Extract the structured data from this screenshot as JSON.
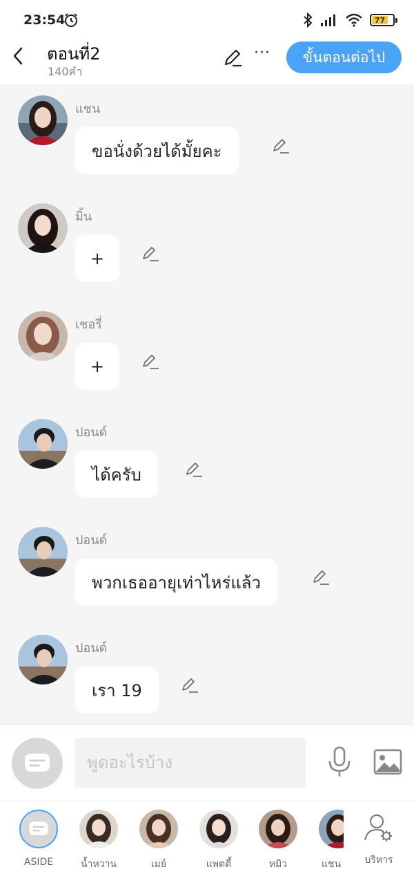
{
  "status_bar": {
    "time": "23:54",
    "battery": "77",
    "icons": [
      "alarm-icon",
      "bluetooth-icon",
      "signal-icon",
      "wifi-icon",
      "battery-icon"
    ]
  },
  "header": {
    "title": "ตอนที่2",
    "subtitle": "140คำ",
    "next_button": "ขั้นตอนต่อไป",
    "more_label": "···"
  },
  "messages": [
    {
      "sender": "แชน",
      "text": "ขอนั่งด้วยได้มั้ยคะ"
    },
    {
      "sender": "มิ้น",
      "text": "+"
    },
    {
      "sender": "เชอรี่",
      "text": "+"
    },
    {
      "sender": "ปอนด์",
      "text": "ได้ครับ"
    },
    {
      "sender": "ปอนด์",
      "text": "พวกเธออายุเท่าไหร่แล้ว"
    },
    {
      "sender": "ปอนด์",
      "text": "เรา 19"
    }
  ],
  "composer": {
    "placeholder": "พูดอะไรบ้าง"
  },
  "bottom_nav": [
    {
      "label": "ASIDE"
    },
    {
      "label": "น้ำหวาน"
    },
    {
      "label": "เมย์"
    },
    {
      "label": "แพตตี้"
    },
    {
      "label": "หมิว"
    },
    {
      "label": "แชน"
    },
    {
      "label": "บริหาร"
    }
  ],
  "colors": {
    "accent": "#4aa3f5",
    "background": "#f5f5f5",
    "bubble": "#ffffff",
    "battery": "#f5c542"
  }
}
